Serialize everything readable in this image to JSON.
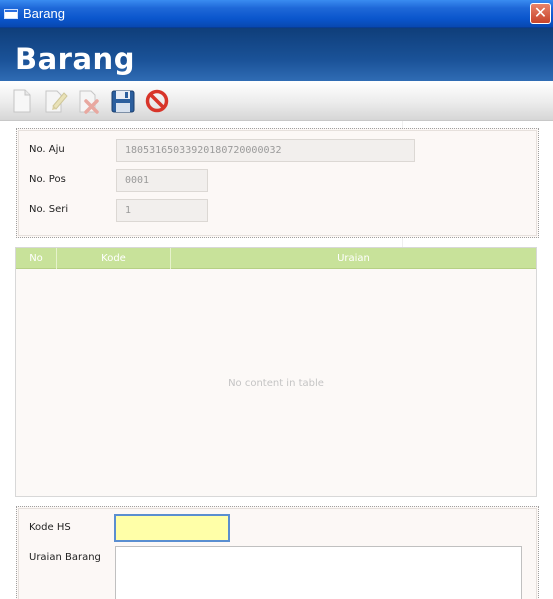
{
  "window": {
    "title": "Barang",
    "close_glyph": "✕"
  },
  "header": {
    "title": "Barang"
  },
  "toolbar": {
    "buttons": [
      {
        "name": "new-icon",
        "enabled": false
      },
      {
        "name": "edit-icon",
        "enabled": false
      },
      {
        "name": "delete-icon",
        "enabled": false
      },
      {
        "name": "save-icon",
        "enabled": true
      },
      {
        "name": "cancel-icon",
        "enabled": true
      }
    ]
  },
  "info": {
    "no_aju_label": "No. Aju",
    "no_aju_value": "18053165033920180720000032",
    "no_pos_label": "No. Pos",
    "no_pos_value": "0001",
    "no_seri_label": "No. Seri",
    "no_seri_value": "1"
  },
  "table": {
    "columns": [
      "No",
      "Kode",
      "Uraian"
    ],
    "rows": [],
    "empty_message": "No content in table"
  },
  "form": {
    "kode_hs_label": "Kode HS",
    "kode_hs_value": "",
    "uraian_label": "Uraian Barang",
    "uraian_value": ""
  },
  "colors": {
    "titlebar": "#1e68d8",
    "banner": "#1a5298",
    "table_header": "#c8e29a",
    "active_input": "#ffffa8",
    "cancel_red": "#d8352a",
    "save_blue": "#2c5f9e"
  }
}
